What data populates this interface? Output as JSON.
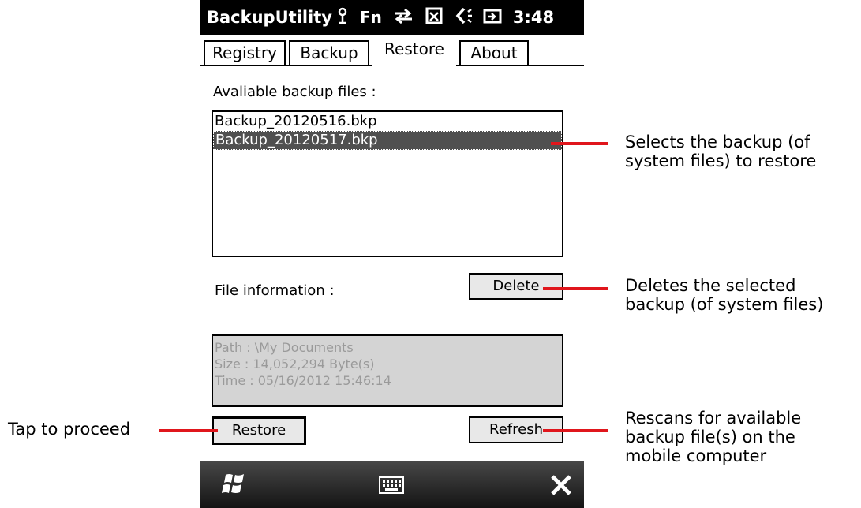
{
  "status_bar": {
    "app_title": "BackupUtility",
    "icons": [
      "antenna-icon",
      "fn-indicator",
      "sync-arrows-icon",
      "signal-off-icon",
      "speaker-icon",
      "battery-charging-icon"
    ],
    "fn_label": "Fn",
    "time": "3:48"
  },
  "tabs": [
    {
      "label": "Registry",
      "active": false
    },
    {
      "label": "Backup",
      "active": false
    },
    {
      "label": "Restore",
      "active": true
    },
    {
      "label": "About",
      "active": false
    }
  ],
  "restore": {
    "files_label": "Avaliable backup files :",
    "files": [
      {
        "name": "Backup_20120516.bkp",
        "selected": false
      },
      {
        "name": "Backup_20120517.bkp",
        "selected": true
      }
    ],
    "file_info_label": "File information :",
    "delete_label": "Delete",
    "info_lines": [
      "Path : \\My Documents",
      "Size : 14,052,294 Byte(s)",
      "Time : 05/16/2012 15:46:14"
    ],
    "restore_label": "Restore",
    "refresh_label": "Refresh"
  },
  "taskbar": {
    "icons": [
      "windows-start-icon",
      "keyboard-icon",
      "close-icon"
    ]
  },
  "annotations": {
    "select_backup": "Selects the backup (of\nsystem files) to restore",
    "delete": "Deletes the selected\nbackup (of system files)",
    "refresh": "Rescans for available\nbackup file(s) on the\nmobile computer",
    "proceed": "Tap to proceed",
    "accent_color": "#e0161c"
  }
}
